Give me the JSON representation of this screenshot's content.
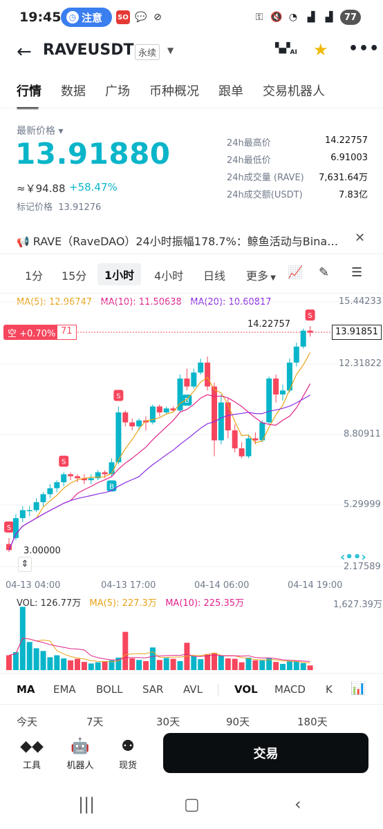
{
  "status_bar": {
    "time": "19:45",
    "notification_pill": "注意",
    "pill_icon": "◷",
    "battery": "77"
  },
  "header": {
    "symbol": "RAVEUSDT",
    "contract_type": "永续",
    "ai_label": "AI"
  },
  "main_tabs": [
    "行情",
    "数据",
    "广场",
    "币种概况",
    "跟单",
    "交易机器人"
  ],
  "price": {
    "last_label": "最新价格",
    "last": "13.91880",
    "approx_cny": "≈￥94.88",
    "change_pct": "+58.47%",
    "mark_label": "标记价格",
    "mark": "13.91276",
    "color": "#0ab5c9"
  },
  "stats": [
    {
      "key": "24h最高价",
      "value": "14.22757"
    },
    {
      "key": "24h最低价",
      "value": "6.91003"
    },
    {
      "key": "24h成交量 (RAVE)",
      "value": "7,631.64万"
    },
    {
      "key": "24h成交额(USDT)",
      "value": "7.83亿"
    }
  ],
  "news": {
    "text": "RAVE（RaveDAO）24小时振幅178.7%：鲸鱼活动与Bina…"
  },
  "intervals": {
    "items": [
      "1分",
      "15分",
      "1小时",
      "4小时",
      "日线",
      "更多"
    ],
    "active": "1小时"
  },
  "ma_legend": {
    "ma5": "MA(5): 12.96747",
    "ma10": "MA(10): 11.50638",
    "ma20": "MA(20): 10.60817",
    "ma5_color": "#e8a317",
    "ma10_color": "#e0218a",
    "ma20_color": "#8a2be2"
  },
  "position_tag": {
    "side": "空 +0.70%",
    "leverage": "71"
  },
  "chart_data": {
    "type": "candlestick",
    "y_ticks": [
      "15.44233",
      "12.31822",
      "8.80911",
      "5.29999",
      "2.17589"
    ],
    "ylim": [
      2.17589,
      15.44233
    ],
    "x_ticks": [
      "04-13 04:00",
      "04-13 17:00",
      "04-14 06:00",
      "04-14 19:00"
    ],
    "high_label": "14.22757",
    "low_label": "3.00000",
    "current_price": "13.91851",
    "up_color": "#2ebd85",
    "down_color": "#f6465d",
    "candles": [
      [
        3.3,
        3.6,
        2.9,
        3.0,
        "s"
      ],
      [
        3.6,
        4.8,
        3.5,
        4.6,
        ""
      ],
      [
        4.6,
        5.2,
        4.4,
        5.0,
        ""
      ],
      [
        5.0,
        5.2,
        4.7,
        5.0,
        ""
      ],
      [
        5.0,
        5.6,
        4.9,
        5.4,
        ""
      ],
      [
        5.4,
        5.9,
        5.2,
        5.8,
        ""
      ],
      [
        5.8,
        6.3,
        5.6,
        6.1,
        ""
      ],
      [
        6.1,
        6.5,
        5.9,
        6.4,
        ""
      ],
      [
        6.4,
        6.9,
        6.2,
        6.8,
        "s"
      ],
      [
        6.8,
        6.9,
        6.5,
        6.7,
        ""
      ],
      [
        6.7,
        6.8,
        6.4,
        6.6,
        ""
      ],
      [
        6.6,
        6.8,
        6.3,
        6.5,
        ""
      ],
      [
        6.5,
        6.8,
        6.3,
        6.6,
        ""
      ],
      [
        6.6,
        7.0,
        6.5,
        6.9,
        ""
      ],
      [
        6.9,
        7.0,
        6.6,
        6.8,
        ""
      ],
      [
        6.8,
        7.6,
        6.7,
        7.4,
        "b"
      ],
      [
        7.4,
        10.2,
        7.3,
        9.9,
        "s"
      ],
      [
        9.9,
        10.0,
        9.2,
        9.4,
        ""
      ],
      [
        9.4,
        9.6,
        9.0,
        9.2,
        ""
      ],
      [
        9.2,
        9.6,
        9.0,
        9.5,
        ""
      ],
      [
        9.5,
        9.7,
        9.0,
        9.4,
        ""
      ],
      [
        9.4,
        10.3,
        9.3,
        10.2,
        ""
      ],
      [
        10.2,
        10.3,
        9.7,
        9.9,
        ""
      ],
      [
        9.9,
        10.2,
        9.8,
        10.1,
        ""
      ],
      [
        10.1,
        10.2,
        9.9,
        10.0,
        ""
      ],
      [
        10.0,
        11.8,
        9.9,
        11.6,
        ""
      ],
      [
        11.6,
        12.1,
        11.0,
        11.2,
        "b"
      ],
      [
        11.2,
        12.1,
        11.1,
        11.9,
        ""
      ],
      [
        11.9,
        12.6,
        11.8,
        12.4,
        ""
      ],
      [
        12.4,
        12.7,
        11.0,
        11.2,
        ""
      ],
      [
        11.2,
        11.4,
        7.7,
        8.5,
        ""
      ],
      [
        8.5,
        10.8,
        8.3,
        10.4,
        ""
      ],
      [
        10.4,
        10.6,
        8.6,
        9.0,
        ""
      ],
      [
        9.0,
        9.3,
        7.9,
        8.1,
        ""
      ],
      [
        8.1,
        8.4,
        7.6,
        7.7,
        ""
      ],
      [
        7.7,
        8.8,
        7.6,
        8.6,
        ""
      ],
      [
        8.6,
        8.9,
        8.3,
        8.5,
        ""
      ],
      [
        8.5,
        9.5,
        8.4,
        9.4,
        ""
      ],
      [
        9.4,
        11.7,
        9.3,
        11.6,
        ""
      ],
      [
        11.6,
        11.8,
        10.4,
        10.8,
        ""
      ],
      [
        10.8,
        11.3,
        10.5,
        11.0,
        ""
      ],
      [
        11.0,
        12.6,
        10.9,
        12.4,
        ""
      ],
      [
        12.4,
        13.4,
        12.2,
        13.2,
        ""
      ],
      [
        13.2,
        14.1,
        13.1,
        14.0,
        ""
      ],
      [
        14.0,
        14.23,
        13.7,
        13.9,
        "s"
      ]
    ],
    "volume": {
      "label": "VOL: 126.77万",
      "ma5": "MA(5): 227.3万",
      "ma10": "MA(10): 225.35万",
      "max_tick": "1,627.39万",
      "values": [
        380,
        460,
        1620,
        720,
        560,
        490,
        330,
        380,
        300,
        250,
        290,
        210,
        170,
        200,
        230,
        250,
        320,
        980,
        300,
        260,
        230,
        580,
        260,
        310,
        290,
        230,
        700,
        360,
        280,
        410,
        440,
        380,
        300,
        290,
        200,
        320,
        250,
        250,
        300,
        210,
        160,
        230,
        220,
        180,
        120
      ],
      "up_color": "#0ab5c9",
      "down_color": "#f6465d"
    }
  },
  "indicator_tabs": [
    "MA",
    "EMA",
    "BOLL",
    "SAR",
    "AVL",
    "VOL",
    "MACD",
    "K"
  ],
  "range_tabs": [
    "今天",
    "7天",
    "30天",
    "90天",
    "180天"
  ],
  "actions": [
    {
      "label": "工具",
      "icon": "tools-icon"
    },
    {
      "label": "机器人",
      "icon": "robot-icon"
    },
    {
      "label": "现货",
      "icon": "spot-icon"
    }
  ],
  "trade_button": "交易"
}
